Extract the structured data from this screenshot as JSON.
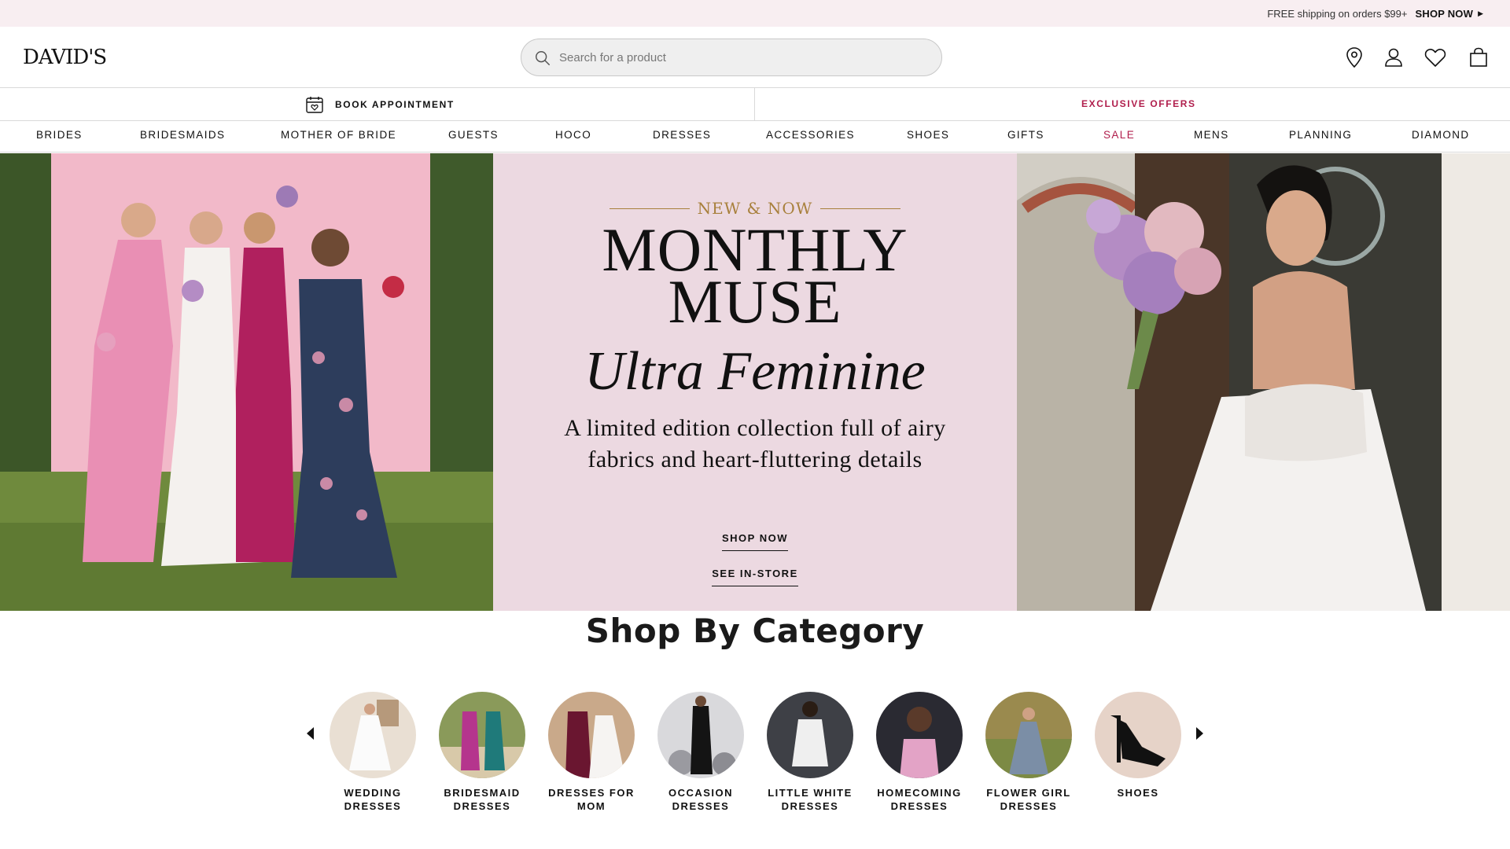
{
  "promo": {
    "text": "FREE shipping on orders $99+",
    "link": "SHOP NOW"
  },
  "header": {
    "logo": "DAVID'S",
    "search_placeholder": "Search for a product"
  },
  "utility": {
    "book_appointment": "BOOK APPOINTMENT",
    "exclusive_offers": "EXCLUSIVE OFFERS"
  },
  "nav": {
    "items": [
      {
        "label": "BRIDES"
      },
      {
        "label": "BRIDESMAIDS"
      },
      {
        "label": "MOTHER OF BRIDE"
      },
      {
        "label": "GUESTS"
      },
      {
        "label": "HOCO"
      },
      {
        "label": "DRESSES"
      },
      {
        "label": "ACCESSORIES"
      },
      {
        "label": "SHOES"
      },
      {
        "label": "GIFTS"
      },
      {
        "label": "SALE"
      },
      {
        "label": "MENS"
      },
      {
        "label": "PLANNING"
      },
      {
        "label": "DIAMOND"
      }
    ]
  },
  "hero": {
    "eyebrow": "NEW & NOW",
    "headline_1": "MONTHLY",
    "headline_2": "MUSE",
    "subhead": "Ultra Feminine",
    "description_1": "A limited edition collection full of airy",
    "description_2": "fabrics and heart-fluttering details",
    "cta_primary": "SHOP NOW",
    "cta_secondary": "SEE IN-STORE"
  },
  "categories": {
    "title": "Shop By Category",
    "items": [
      {
        "line1": "WEDDING",
        "line2": "DRESSES"
      },
      {
        "line1": "BRIDESMAID",
        "line2": "DRESSES"
      },
      {
        "line1": "DRESSES FOR",
        "line2": "MOM"
      },
      {
        "line1": "OCCASION",
        "line2": "DRESSES"
      },
      {
        "line1": "LITTLE WHITE",
        "line2": "DRESSES"
      },
      {
        "line1": "HOMECOMING",
        "line2": "DRESSES"
      },
      {
        "line1": "FLOWER GIRL",
        "line2": "DRESSES"
      },
      {
        "line1": "SHOES",
        "line2": ""
      }
    ]
  },
  "colors": {
    "accent": "#b01e4c",
    "gold": "#a8803c",
    "hero_bg": "#ecd9e1",
    "promo_bg": "#f8eef1"
  }
}
